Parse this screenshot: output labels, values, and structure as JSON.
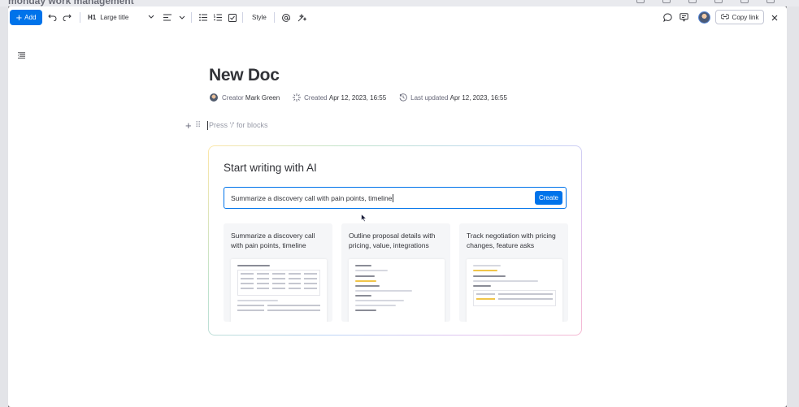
{
  "background": {
    "app_title": "monday work management"
  },
  "toolbar": {
    "add_label": "Add",
    "heading_prefix": "H1",
    "heading_style": "Large title",
    "style_label": "Style",
    "copy_link_label": "Copy link"
  },
  "doc": {
    "title": "New Doc",
    "creator_label": "Creator",
    "creator_name": "Mark Green",
    "created_label": "Created",
    "created_date": "Apr 12, 2023, 16:55",
    "updated_label": "Last updated",
    "updated_date": "Apr 12, 2023, 16:55",
    "block_placeholder": "Press '/' for blocks"
  },
  "ai": {
    "title": "Start writing with AI",
    "input_value": "Summarize a discovery call with pain points, timeline",
    "create_label": "Create",
    "templates": [
      {
        "label": "Summarize a discovery call with pain points, timeline"
      },
      {
        "label": "Outline proposal details with pricing, value, integrations"
      },
      {
        "label": "Track negotiation with pricing changes, feature asks"
      }
    ]
  },
  "colors": {
    "primary": "#0073ea",
    "text": "#323338",
    "muted": "#676879"
  },
  "icons": [
    "plus-icon",
    "undo-icon",
    "redo-icon",
    "chevron-down-icon",
    "align-left-icon",
    "bullet-list-icon",
    "numbered-list-icon",
    "checklist-icon",
    "mention-icon",
    "ai-sparkle-icon",
    "comment-icon",
    "updates-icon",
    "link-icon",
    "close-icon",
    "outline-icon",
    "created-icon",
    "history-icon",
    "drag-handle-icon"
  ]
}
